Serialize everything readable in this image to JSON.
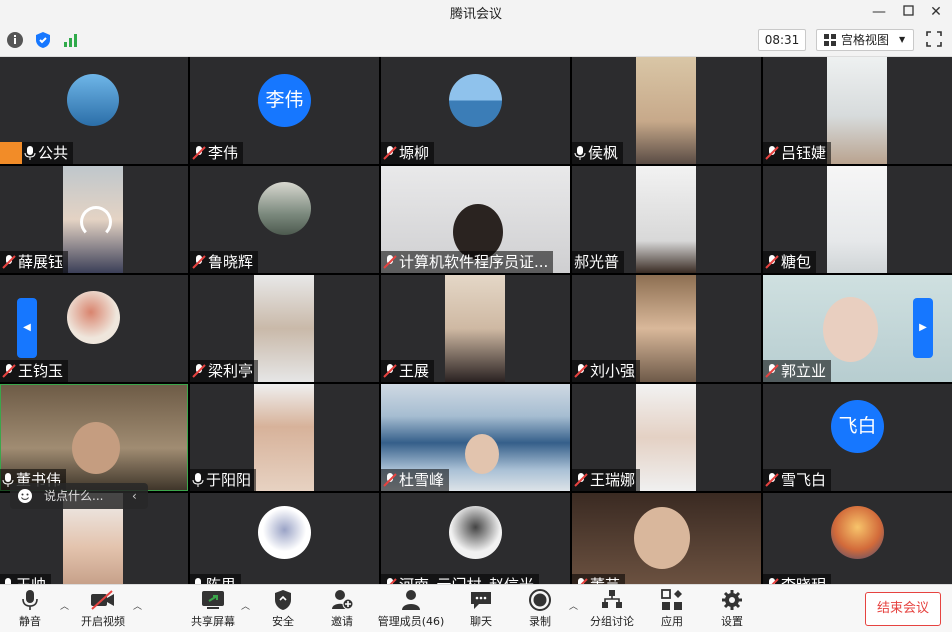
{
  "window": {
    "title": "腾讯会议"
  },
  "infobar": {
    "time": "08:31",
    "layout_label": "宫格视图"
  },
  "chat": {
    "placeholder": "说点什么..."
  },
  "participants": [
    {
      "name": "公共"
    },
    {
      "name": "李伟",
      "avatar_text": "李伟"
    },
    {
      "name": "塬柳"
    },
    {
      "name": "侯枫"
    },
    {
      "name": "吕钰婕"
    },
    {
      "name": "薛展钰"
    },
    {
      "name": "鲁晓辉"
    },
    {
      "name": "计算机软件程序员证..."
    },
    {
      "name": "郝光普"
    },
    {
      "name": "糖包"
    },
    {
      "name": "王钧玉"
    },
    {
      "name": "梁利亭"
    },
    {
      "name": "王展"
    },
    {
      "name": "刘小强"
    },
    {
      "name": "郭立业"
    },
    {
      "name": "董书伟"
    },
    {
      "name": "于阳阳"
    },
    {
      "name": "杜雪峰"
    },
    {
      "name": "王瑞娜"
    },
    {
      "name": "雪飞白",
      "avatar_text": "飞白"
    },
    {
      "name": "王帅"
    },
    {
      "name": "陈思"
    },
    {
      "name": "河南_云门村_赵信光"
    },
    {
      "name": "董芸"
    },
    {
      "name": "李晓玥"
    }
  ],
  "toolbar": {
    "mute": "静音",
    "video": "开启视频",
    "share": "共享屏幕",
    "security": "安全",
    "invite": "邀请",
    "members": "管理成员(46)",
    "chat": "聊天",
    "record": "录制",
    "breakout": "分组讨论",
    "apps": "应用",
    "settings": "设置",
    "end": "结束会议"
  },
  "colors": {
    "accent": "#1677ff",
    "end": "#e64340",
    "active_speaker": "#3ba64b"
  }
}
